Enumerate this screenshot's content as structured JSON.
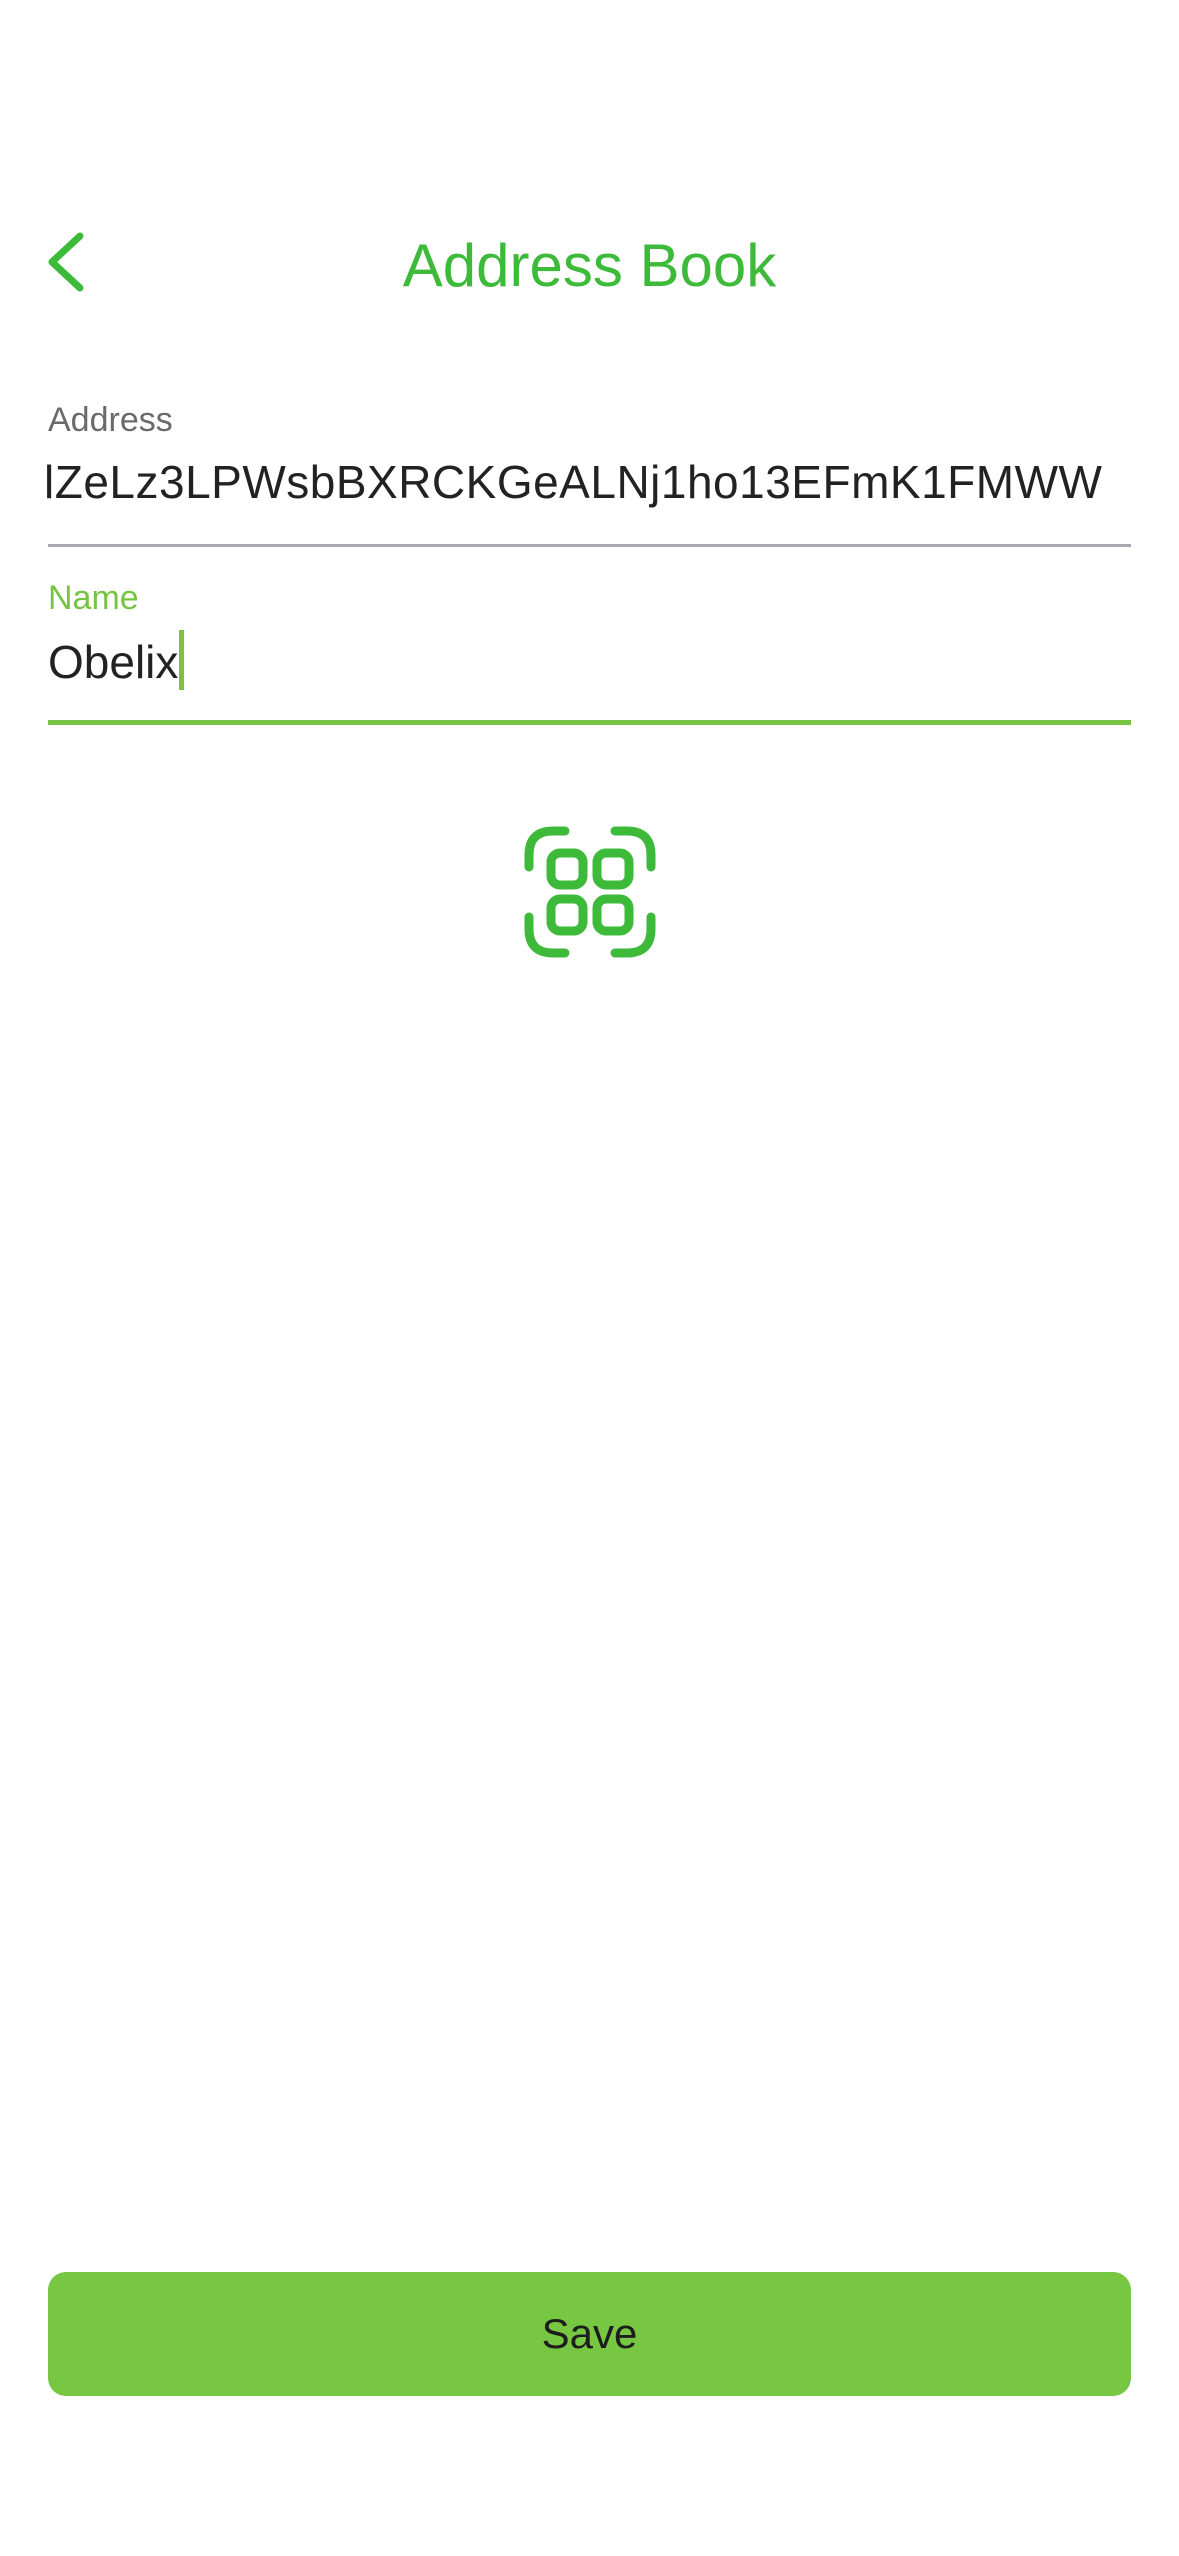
{
  "header": {
    "title": "Address Book",
    "back_icon": "chevron-left-icon"
  },
  "form": {
    "address": {
      "label": "Address",
      "value": "lZeLz3LPWsbBXRCKGeALNj1ho13EFmK1FMWW"
    },
    "name": {
      "label": "Name",
      "value": "Obelix",
      "focused": true
    }
  },
  "scan": {
    "icon": "qr-scan-icon"
  },
  "footer": {
    "save_label": "Save"
  },
  "colors": {
    "accent": "#3dba3a",
    "focus": "#76c442",
    "button_bg": "#78c743",
    "underline_inactive": "#a7a7ad"
  }
}
